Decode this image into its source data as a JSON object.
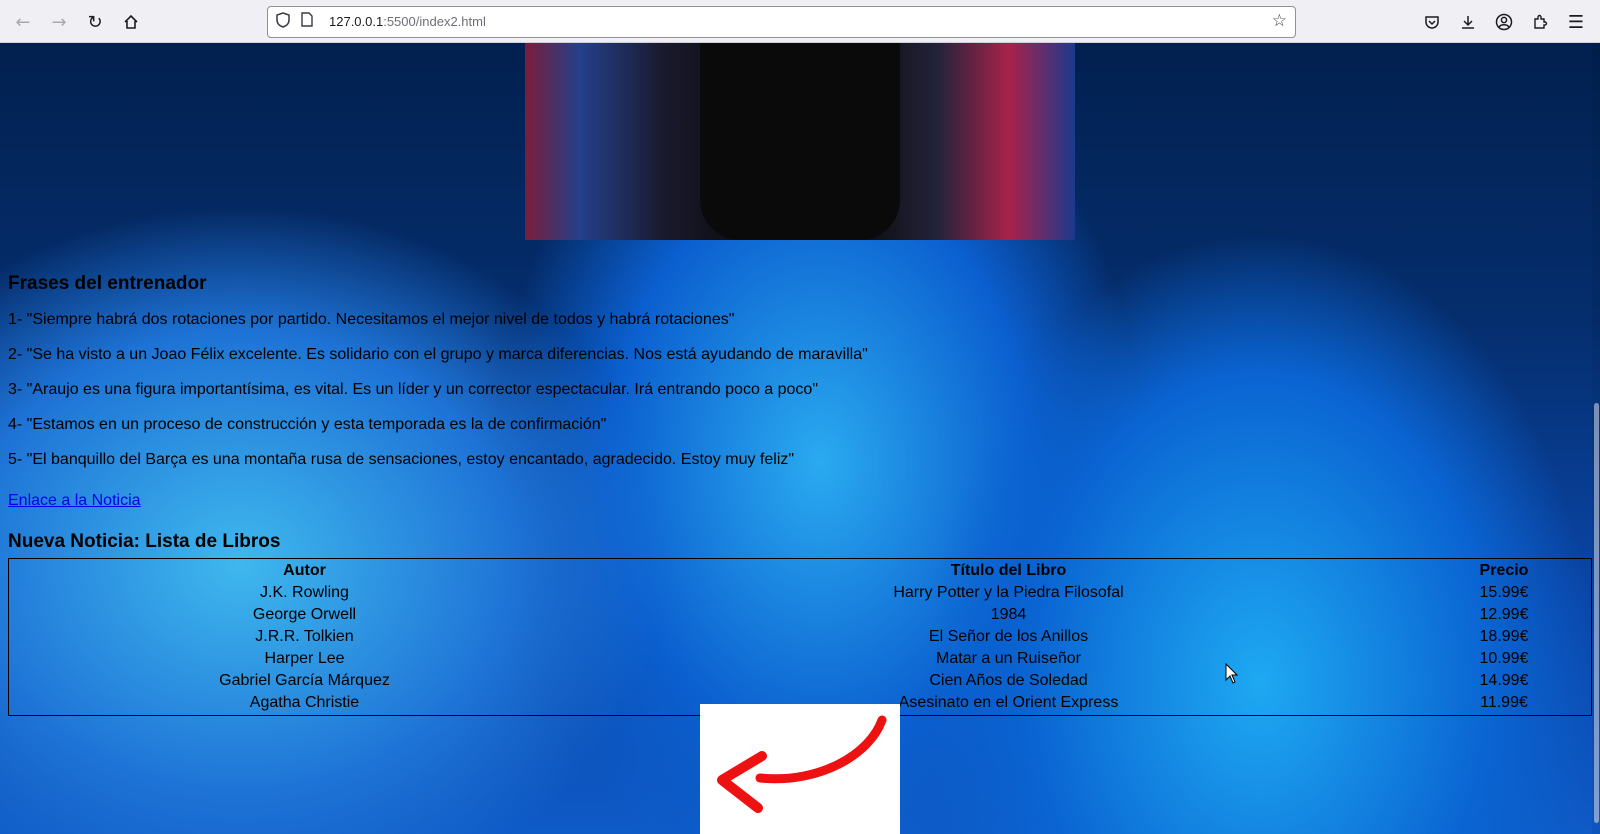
{
  "browser": {
    "url_host": "127.0.0.1",
    "url_rest": ":5500/index2.html",
    "icons": [
      "back-icon",
      "forward-icon",
      "reload-icon",
      "home-icon",
      "shield-icon",
      "page-icon",
      "bookmark-star-icon",
      "pocket-icon",
      "download-icon",
      "account-icon",
      "extensions-icon",
      "menu-icon"
    ]
  },
  "page": {
    "quotes_heading": "Frases del entrenador",
    "quotes": [
      "1- \"Siempre habrá dos rotaciones por partido. Necesitamos el mejor nivel de todos y habrá rotaciones\"",
      "2- \"Se ha visto a un Joao Félix excelente. Es solidario con el grupo y marca diferencias. Nos está ayudando de maravilla\"",
      "3- \"Araujo es una figura importantísima, es vital. Es un líder y un corrector espectacular. Irá entrando poco a poco\"",
      "4- \"Estamos en un proceso de construcción y esta temporada es la de confirmación\"",
      "5- \"El banquillo del Barça es una montaña rusa de sensaciones, estoy encantado, agradecido. Estoy muy feliz\""
    ],
    "link_text": "Enlace a la Noticia",
    "books_heading": "Nueva Noticia: Lista de Libros",
    "table": {
      "headers": [
        "Autor",
        "Título del Libro",
        "Precio"
      ],
      "rows": [
        [
          "J.K. Rowling",
          "Harry Potter y la Piedra Filosofal",
          "15.99€"
        ],
        [
          "George Orwell",
          "1984",
          "12.99€"
        ],
        [
          "J.R.R. Tolkien",
          "El Señor de los Anillos",
          "18.99€"
        ],
        [
          "Harper Lee",
          "Matar a un Ruiseñor",
          "10.99€"
        ],
        [
          "Gabriel García Márquez",
          "Cien Años de Soledad",
          "14.99€"
        ],
        [
          "Agatha Christie",
          "Asesinato en el Orient Express",
          "11.99€"
        ]
      ]
    },
    "link_color": "#0000ee",
    "arrow_color": "#ee1111"
  }
}
